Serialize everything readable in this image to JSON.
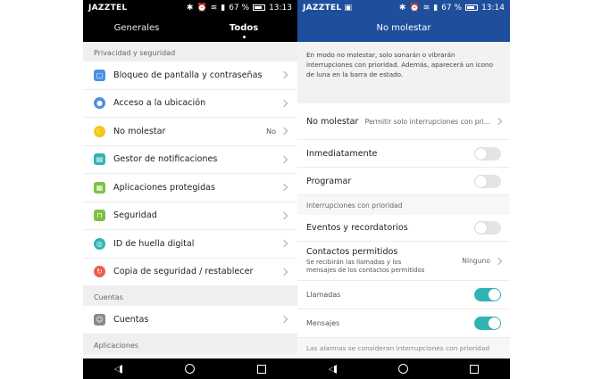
{
  "left": {
    "status": {
      "carrier": "JAZZTEL",
      "battery": "67 %",
      "time": "13:13"
    },
    "tabs": [
      {
        "label": "Generales"
      },
      {
        "label": "Todos"
      }
    ],
    "sections": [
      {
        "title": "Privacidad y seguridad"
      },
      {
        "title": "Cuentas"
      },
      {
        "title": "Aplicaciones"
      }
    ],
    "items": [
      {
        "label": "Bloqueo de pantalla y contraseñas",
        "icon": "lock-screen-icon",
        "color": "#4a90e2"
      },
      {
        "label": "Acceso a la ubicación",
        "icon": "location-icon",
        "color": "#4a90e2"
      },
      {
        "label": "No molestar",
        "value": "No",
        "icon": "moon-icon",
        "color": "#f5c518"
      },
      {
        "label": "Gestor de notificaciones",
        "icon": "notification-icon",
        "color": "#2fb4b4"
      },
      {
        "label": "Aplicaciones protegidas",
        "icon": "protected-apps-icon",
        "color": "#7cc243"
      },
      {
        "label": "Seguridad",
        "icon": "security-lock-icon",
        "color": "#7cc243"
      },
      {
        "label": "ID de huella digital",
        "icon": "fingerprint-icon",
        "color": "#2fb4b4"
      },
      {
        "label": "Copia de seguridad / restablecer",
        "icon": "backup-icon",
        "color": "#f05a4f"
      },
      {
        "label": "Cuentas",
        "icon": "account-icon",
        "color": "#888888"
      }
    ]
  },
  "right": {
    "status": {
      "carrier": "JAZZTEL",
      "battery": "67 %",
      "time": "13:14"
    },
    "title": "No molestar",
    "description": "En modo no molestar, solo sonarán o vibrarán interrupciones con prioridad. Además, aparecerá un icono de luna en la barra de estado.",
    "mode": {
      "label": "No molestar",
      "value": "Permitir solo interrupciones con pri..."
    },
    "immediately": {
      "label": "Inmediatamente"
    },
    "schedule": {
      "label": "Programar"
    },
    "priority_head": "Interrupciones con prioridad",
    "events": {
      "label": "Eventos y recordatorios"
    },
    "contacts": {
      "label": "Contactos permitidos",
      "sub": "Se recibirán las llamadas y los mensajes de los contactos permitidos",
      "value": "Ninguno"
    },
    "calls": {
      "label": "Llamadas"
    },
    "messages": {
      "label": "Mensajes"
    },
    "footer": "Las alarmas se consideran interrupciones con prioridad"
  }
}
